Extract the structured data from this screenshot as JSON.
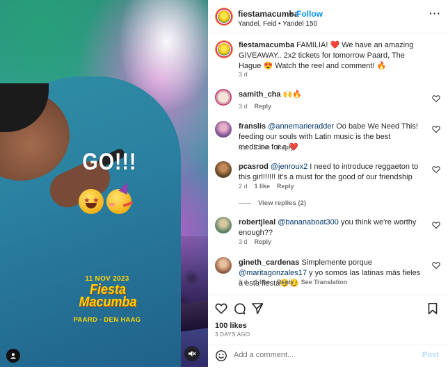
{
  "media": {
    "overlay_text": "GO!!!",
    "event_date": "11 NOV 2023",
    "event_name_line1": "Fiesta",
    "event_name_line2": "Macumba",
    "event_venue": "PAARD - DEN HAAG",
    "emojis": [
      "star-struck-face",
      "partying-face"
    ]
  },
  "header": {
    "username": "fiestamacumba",
    "separator": "•",
    "follow_label": "Follow",
    "subtitle": "Yandel, Feid • Yandel 150",
    "more_label": "···"
  },
  "caption": {
    "username": "fiestamacumba",
    "text": "FAMILIA! ❤️ We have an amazing GIVEAWAY.. 2x2 tickets for tomorrow Paard, The Hague 😍 Watch the reel and comment! 🔥",
    "time": "3 d"
  },
  "comments": [
    {
      "username": "samith_cha",
      "text": "🙌🔥",
      "mention": "",
      "time": "3 d",
      "likes": "",
      "reply_label": "Reply",
      "extra": ""
    },
    {
      "username": "franslis",
      "mention": "@annemarieradder",
      "text": " Oo babe We Need This! feeding our souls with Latin music is the best medicine for a ❤️",
      "time": "2 d",
      "likes": "1 like",
      "reply_label": "Reply",
      "extra": ""
    },
    {
      "username": "pcasrod",
      "mention": "@jenroux2",
      "text": " I need to introduce reggaeton to this girl!!!!!! It's a must for the good of our friendship",
      "time": "2 d",
      "likes": "1 like",
      "reply_label": "Reply",
      "extra": ""
    },
    {
      "username": "robertjleal",
      "mention": "@bananaboat300",
      "text": " you think we're worthy enough??",
      "time": "3 d",
      "likes": "",
      "reply_label": "Reply",
      "extra": ""
    },
    {
      "username": "gineth_cardenas",
      "mention": "@maritagonzales17",
      "text_pre": " Simplemente porque ",
      "text": " y yo somos las latinas más fieles a esta fiesta😏😏",
      "time": "3 d",
      "likes": "1 like",
      "reply_label": "Reply",
      "extra": "See Translation"
    }
  ],
  "view_replies": "View replies (2)",
  "actions": {
    "likes": "100 likes",
    "ago": "3 DAYS AGO",
    "comment_placeholder": "Add a comment...",
    "post_label": "Post"
  },
  "colors": {
    "link_blue": "#0095f6",
    "mention": "#00376b",
    "muted": "#737373",
    "event_yellow": "#ffd400"
  },
  "icons": [
    "heart-icon",
    "comment-icon",
    "share-icon",
    "bookmark-icon",
    "emoji-icon",
    "mute-icon",
    "user-tag-icon",
    "more-icon"
  ]
}
